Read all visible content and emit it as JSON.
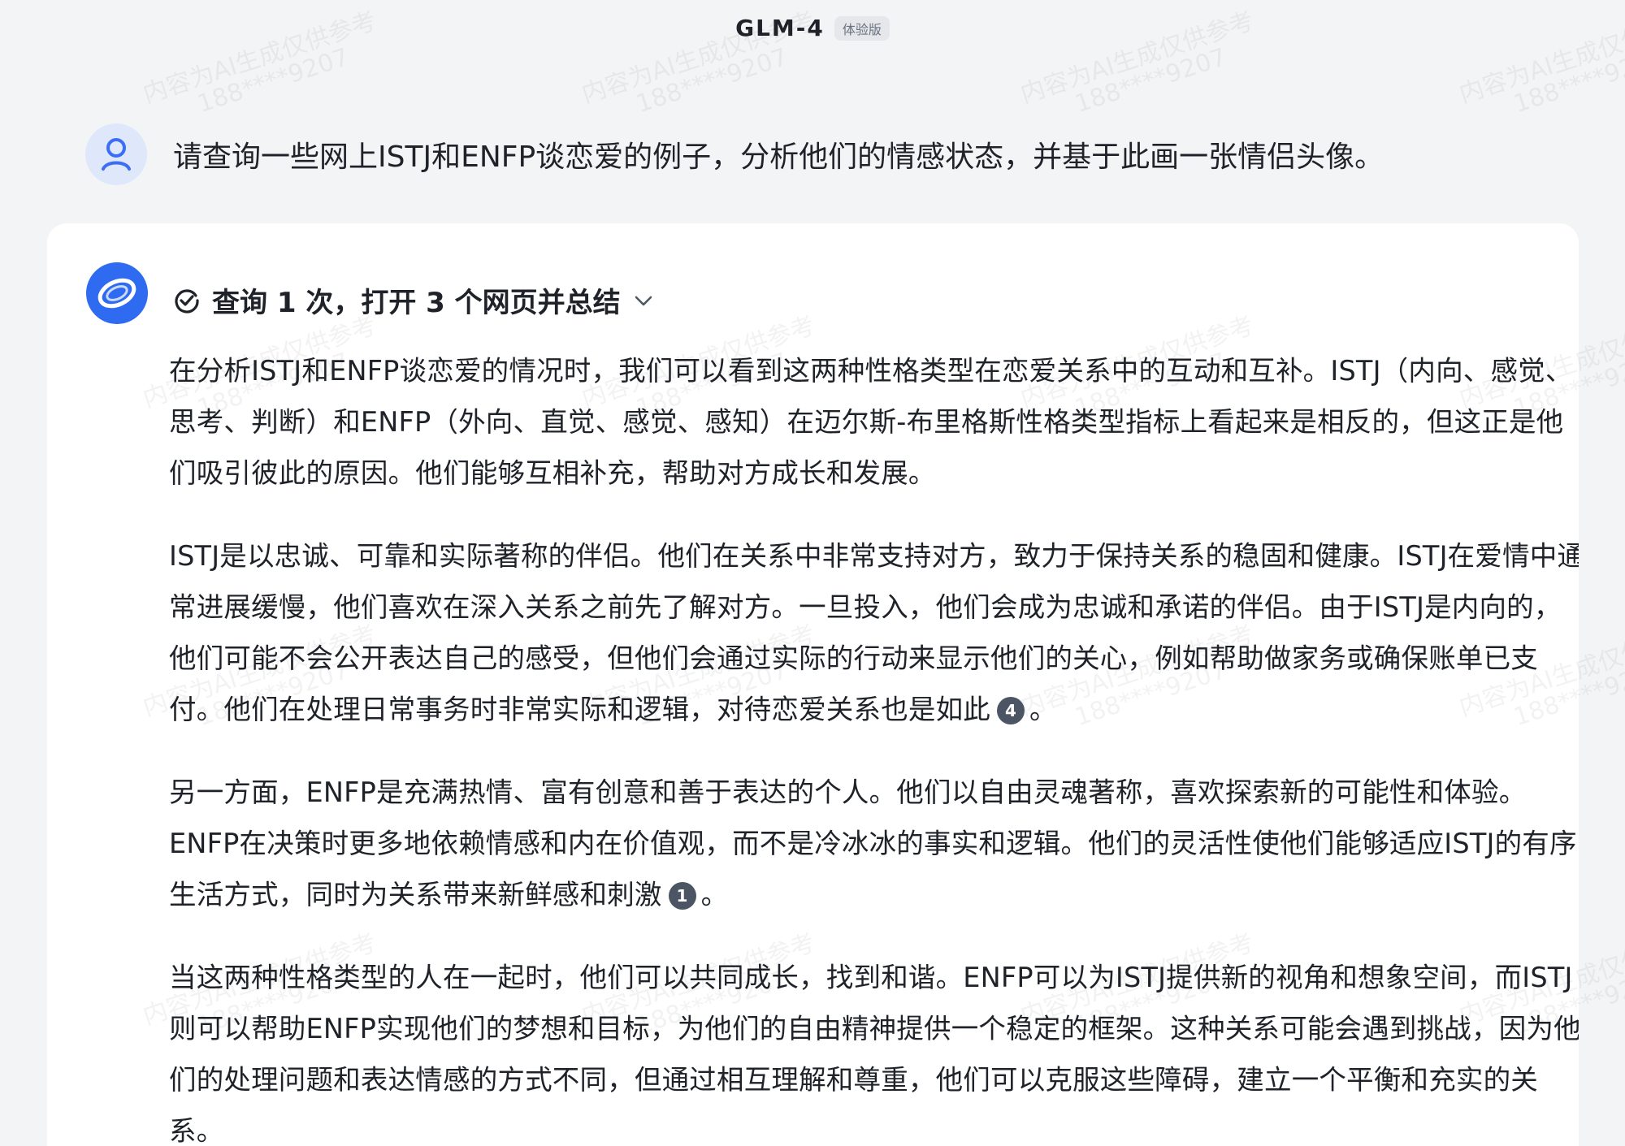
{
  "header": {
    "model_name": "GLM-4",
    "badge": "体验版"
  },
  "watermark": {
    "line1": "内容为AI生成仅供参考",
    "line2": "188****9207"
  },
  "user_message": {
    "text": "请查询一些网上ISTJ和ENFP谈恋爱的例子，分析他们的情感状态，并基于此画一张情侣头像。",
    "avatar_icon": "user-icon"
  },
  "assistant": {
    "avatar_icon": "zhipu-logo-icon",
    "search_summary": "查询 1 次，打开 3 个网页并总结",
    "accent_color": "#2f6bf0",
    "paragraphs": [
      {
        "text": "在分析ISTJ和ENFP谈恋爱的情况时，我们可以看到这两种性格类型在恋爱关系中的互动和互补。ISTJ（内向、感觉、思考、判断）和ENFP（外向、直觉、感觉、感知）在迈尔斯-布里格斯性格类型指标上看起来是相反的，但这正是他们吸引彼此的原因。他们能够互相补充，帮助对方成长和发展。",
        "cite": null
      },
      {
        "text": "ISTJ是以忠诚、可靠和实际著称的伴侣。他们在关系中非常支持对方，致力于保持关系的稳固和健康。ISTJ在爱情中通常进展缓慢，他们喜欢在深入关系之前先了解对方。一旦投入，他们会成为忠诚和承诺的伴侣。由于ISTJ是内向的，他们可能不会公开表达自己的感受，但他们会通过实际的行动来显示他们的关心，例如帮助做家务或确保账单已支付。他们在处理日常事务时非常实际和逻辑，对待恋爱关系也是如此",
        "cite": "4",
        "tail": "。"
      },
      {
        "text": "另一方面，ENFP是充满热情、富有创意和善于表达的个人。他们以自由灵魂著称，喜欢探索新的可能性和体验。ENFP在决策时更多地依赖情感和内在价值观，而不是冷冰冰的事实和逻辑。他们的灵活性使他们能够适应ISTJ的有序生活方式，同时为关系带来新鲜感和刺激",
        "cite": "1",
        "tail": "。"
      },
      {
        "text": "当这两种性格类型的人在一起时，他们可以共同成长，找到和谐。ENFP可以为ISTJ提供新的视角和想象空间，而ISTJ则可以帮助ENFP实现他们的梦想和目标，为他们的自由精神提供一个稳定的框架。这种关系可能会遇到挑战，因为他们的处理问题和表达情感的方式不同，但通过相互理解和尊重，他们可以克服这些障碍，建立一个平衡和充实的关系。",
        "cite": null
      }
    ]
  }
}
